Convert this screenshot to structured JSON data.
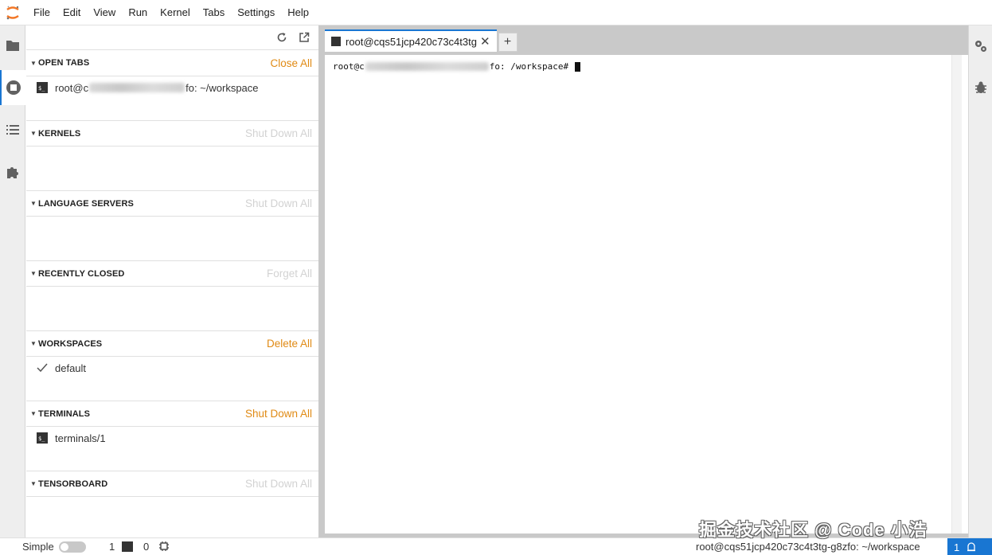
{
  "menubar": {
    "items": [
      "File",
      "Edit",
      "View",
      "Run",
      "Kernel",
      "Tabs",
      "Settings",
      "Help"
    ]
  },
  "left_bar": {
    "icons": [
      "folder-icon",
      "running-icon",
      "toc-icon",
      "extension-icon"
    ]
  },
  "sections": {
    "open_tabs": {
      "title": "OPEN TABS",
      "action": "Close All",
      "entry_prefix": "root@c",
      "entry_suffix": "fo: ~/workspace"
    },
    "kernels": {
      "title": "KERNELS",
      "action": "Shut Down All"
    },
    "language_servers": {
      "title": "LANGUAGE SERVERS",
      "action": "Shut Down All"
    },
    "recently_closed": {
      "title": "RECENTLY CLOSED",
      "action": "Forget All"
    },
    "workspaces": {
      "title": "WORKSPACES",
      "action": "Delete All",
      "entry": "default"
    },
    "terminals": {
      "title": "TERMINALS",
      "action": "Shut Down All",
      "entry": "terminals/1"
    },
    "tensorboard": {
      "title": "TENSORBOARD",
      "action": "Shut Down All"
    }
  },
  "main": {
    "tab_label": "root@cqs51jcp420c73c4t3tg",
    "terminal": {
      "prompt_prefix": "root@c",
      "prompt_suffix": "fo: /workspace#"
    }
  },
  "statusbar": {
    "mode_label": "Simple",
    "kernel_count": "1",
    "terminal_count": "0",
    "path": "root@cqs51jcp420c73c4t3tg-g8zfo: ~/workspace",
    "notification_count": "1"
  },
  "watermark": "掘金技术社区 @ Code 小浩"
}
